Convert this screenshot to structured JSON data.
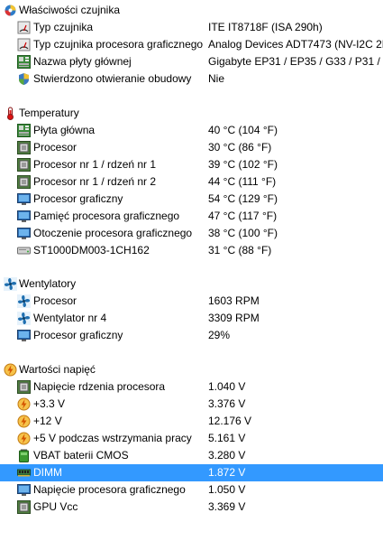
{
  "sections": [
    {
      "title": "Właściwości czujnika",
      "icon": "shield-info-icon",
      "items": [
        {
          "label": "Typ czujnika",
          "value": "ITE IT8718F  (ISA 290h)",
          "icon": "sensor-icon"
        },
        {
          "label": "Typ czujnika procesora graficznego",
          "value": "Analog Devices ADT7473  (NV-I2C 2E",
          "icon": "sensor-icon"
        },
        {
          "label": "Nazwa płyty głównej",
          "value": "Gigabyte EP31 / EP35 / G33 / P31 / P3",
          "icon": "motherboard-icon"
        },
        {
          "label": "Stwierdzono otwieranie obudowy",
          "value": "Nie",
          "icon": "shield-icon"
        }
      ]
    },
    {
      "title": "Temperatury",
      "icon": "thermometer-icon",
      "items": [
        {
          "label": "Płyta główna",
          "value": "40 °C  (104 °F)",
          "icon": "motherboard-icon"
        },
        {
          "label": "Procesor",
          "value": "30 °C  (86 °F)",
          "icon": "cpu-icon"
        },
        {
          "label": "Procesor nr 1 / rdzeń nr 1",
          "value": "39 °C  (102 °F)",
          "icon": "cpu-icon"
        },
        {
          "label": "Procesor nr 1 / rdzeń nr 2",
          "value": "44 °C  (111 °F)",
          "icon": "cpu-icon"
        },
        {
          "label": "Procesor graficzny",
          "value": "54 °C  (129 °F)",
          "icon": "monitor-icon"
        },
        {
          "label": "Pamięć procesora graficznego",
          "value": "47 °C  (117 °F)",
          "icon": "monitor-icon"
        },
        {
          "label": "Otoczenie procesora graficznego",
          "value": "38 °C  (100 °F)",
          "icon": "monitor-icon"
        },
        {
          "label": "ST1000DM003-1CH162",
          "value": "31 °C  (88 °F)",
          "icon": "hard-drive-icon"
        }
      ]
    },
    {
      "title": "Wentylatory",
      "icon": "fan-icon",
      "items": [
        {
          "label": "Procesor",
          "value": "1603 RPM",
          "icon": "fan-icon"
        },
        {
          "label": "Wentylator nr 4",
          "value": "3309 RPM",
          "icon": "fan-icon"
        },
        {
          "label": "Procesor graficzny",
          "value": "29%",
          "icon": "monitor-icon"
        }
      ]
    },
    {
      "title": "Wartości napięć",
      "icon": "voltage-icon",
      "items": [
        {
          "label": "Napięcie rdzenia procesora",
          "value": "1.040 V",
          "icon": "cpu-icon"
        },
        {
          "label": "+3.3 V",
          "value": "3.376 V",
          "icon": "voltage-icon"
        },
        {
          "label": "+12 V",
          "value": "12.176 V",
          "icon": "voltage-icon"
        },
        {
          "label": "+5 V podczas wstrzymania pracy",
          "value": "5.161 V",
          "icon": "voltage-icon"
        },
        {
          "label": "VBAT baterii CMOS",
          "value": "3.280 V",
          "icon": "battery-icon"
        },
        {
          "label": "DIMM",
          "value": "1.872 V",
          "icon": "memory-icon",
          "selected": true
        },
        {
          "label": "Napięcie procesora graficznego",
          "value": "1.050 V",
          "icon": "monitor-icon"
        },
        {
          "label": "GPU Vcc",
          "value": "3.369 V",
          "icon": "cpu-icon"
        }
      ]
    }
  ],
  "colors": {
    "selection": "#3399ff",
    "selection_text": "#ffffff"
  }
}
